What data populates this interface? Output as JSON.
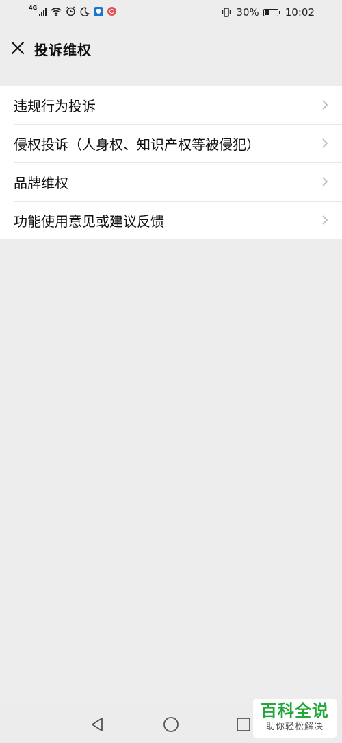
{
  "status_bar": {
    "network": "4G",
    "battery_text": "30%",
    "time": "10:02"
  },
  "header": {
    "title": "投诉维权",
    "close_icon": "close-icon"
  },
  "menu": {
    "items": [
      {
        "label": "违规行为投诉"
      },
      {
        "label": "侵权投诉（人身权、知识产权等被侵犯）"
      },
      {
        "label": "品牌维权"
      },
      {
        "label": "功能使用意见或建议反馈"
      }
    ]
  },
  "watermark": {
    "title": "百科全说",
    "subtitle": "助你轻松解决"
  },
  "colors": {
    "background": "#ededed",
    "list_background": "#ffffff",
    "watermark_green": "#22a83a"
  }
}
